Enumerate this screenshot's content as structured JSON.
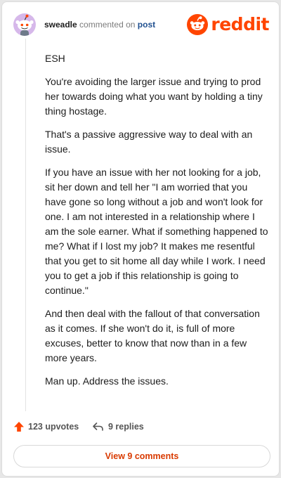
{
  "header": {
    "username": "sweadle",
    "action_text": "commented on",
    "post_link": "post",
    "logo_text": "reddit"
  },
  "comment": {
    "paragraphs": [
      "ESH",
      "You're avoiding the larger issue and trying to prod her towards doing what you want by holding a tiny thing hostage.",
      "That's a passive aggressive way to deal with an issue.",
      "If you have an issue with her not looking for a job, sit her down and tell her \"I am worried that you have gone so long without a job and won't look for one. I am not interested in a relationship where I am the sole earner. What if something happened to me? What if I lost my job? It makes me resentful that you get to sit home all day while I work. I need you to get a job if this relationship is going to continue.\"",
      "And then deal with the fallout of that conversation as it comes. If she won't do it, is full of more excuses, better to know that now than in a few more years.",
      "Man up. Address the issues."
    ]
  },
  "actions": {
    "upvotes": "123 upvotes",
    "replies": "9 replies",
    "view_comments": "View 9 comments"
  },
  "colors": {
    "brand": "#ff4500",
    "link": "#1f4f8f",
    "avatar_bg": "#d6b8ea"
  }
}
